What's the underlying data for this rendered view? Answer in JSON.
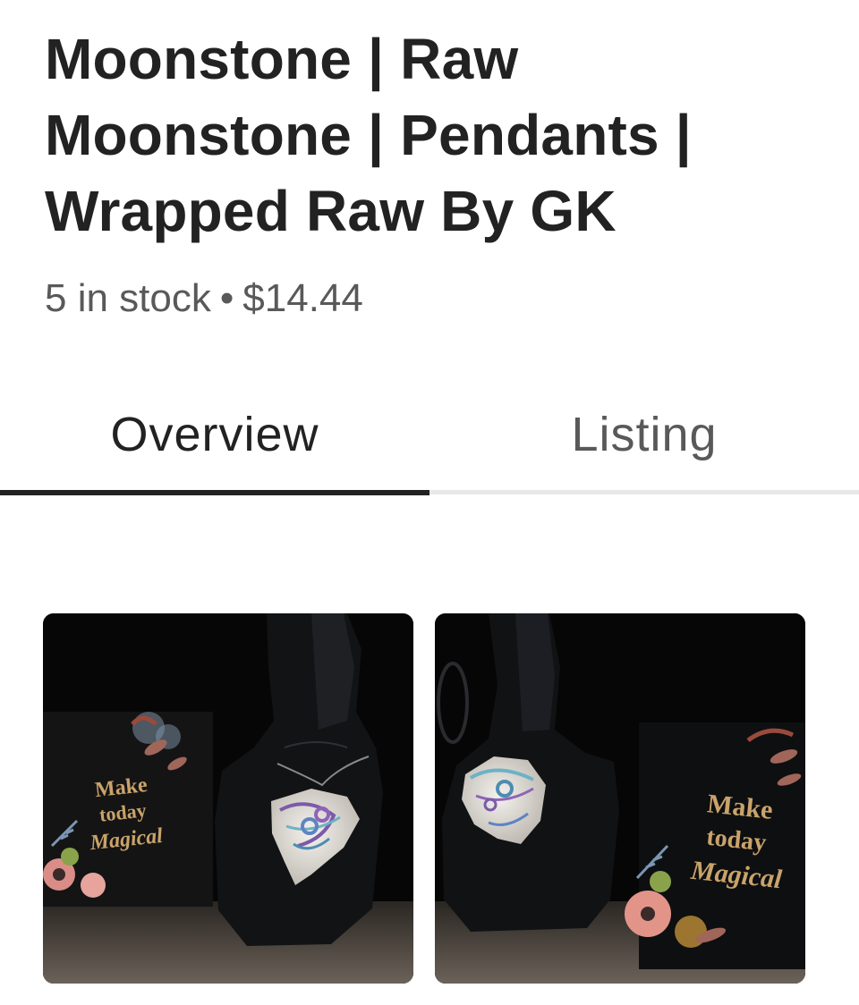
{
  "listing": {
    "title_lines": [
      "Moonstone | Raw",
      "Moonstone | Pendants |",
      "Wrapped Raw By GK"
    ],
    "stock": "5 in stock",
    "separator": "•",
    "price": "$14.44"
  },
  "tabs": [
    {
      "label": "Overview",
      "active": true
    },
    {
      "label": "Listing",
      "active": false
    }
  ],
  "photos": [
    {
      "card_text": [
        "Make",
        "today",
        "Magical"
      ]
    },
    {
      "card_text": [
        "Make",
        "today",
        "Magical"
      ]
    }
  ],
  "colors": {
    "text_primary": "#222222",
    "text_secondary": "#595959",
    "tab_indicator": "#222222",
    "tab_track": "#e8e8e8",
    "card_gold": "#c9a36a"
  }
}
